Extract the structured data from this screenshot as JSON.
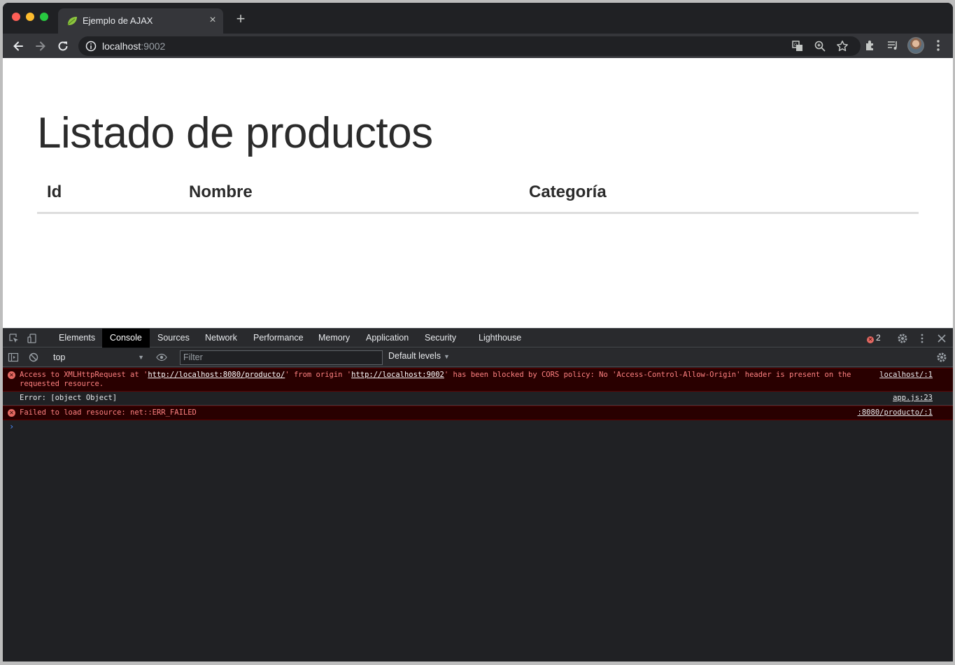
{
  "browser": {
    "tab": {
      "title": "Ejemplo de AJAX",
      "close": "×"
    },
    "new_tab": "+",
    "url": {
      "host": "localhost",
      "port": ":9002"
    }
  },
  "page": {
    "heading": "Listado de productos",
    "table": {
      "columns": [
        "Id",
        "Nombre",
        "Categoría"
      ]
    }
  },
  "devtools": {
    "tabs": [
      "Elements",
      "Console",
      "Sources",
      "Network",
      "Performance",
      "Memory",
      "Application",
      "Security",
      "Lighthouse"
    ],
    "active_tab": "Console",
    "error_count": "2",
    "context": "top",
    "filter_placeholder": "Filter",
    "levels": "Default levels",
    "messages": [
      {
        "type": "error",
        "parts": {
          "p1": "Access to XMLHttpRequest at '",
          "link1": "http://localhost:8080/producto/",
          "p2": "' from origin '",
          "link2": "http://localhost:9002",
          "p3": "' has been blocked by CORS policy: No 'Access-Control-Allow-Origin' header is present on the requested resource."
        },
        "source": "localhost/:1"
      },
      {
        "type": "log",
        "text": "Error: [object Object]",
        "source": "app.js:23"
      },
      {
        "type": "error",
        "text": "Failed to load resource: net::ERR_FAILED",
        "source": ":8080/producto/:1"
      }
    ],
    "prompt": "›"
  },
  "colors": {
    "chrome_bg": "#202124",
    "toolbar_bg": "#35363a",
    "error_bg": "#290000",
    "error_text": "#ff8080"
  }
}
